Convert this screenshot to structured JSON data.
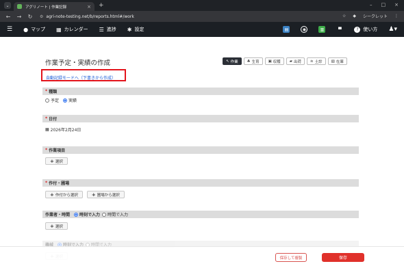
{
  "browser": {
    "tab_title": "アグリノート | 作業記録",
    "url": "agri-note-testing.net/b/reports.html#/work",
    "profile_label": "シークレット"
  },
  "nav": {
    "map": "マップ",
    "calendar": "カレンダー",
    "progress": "進捗",
    "settings": "設定",
    "help": "使い方"
  },
  "page": {
    "title": "作業予定・実績の作成",
    "auto_link": "自動記録モードへ（下書きから作成）"
  },
  "work_tabs": [
    "作業",
    "生育",
    "収穫",
    "出荷",
    "土診",
    "在庫"
  ],
  "sections": {
    "kind": {
      "label": "種類",
      "options": [
        "予定",
        "実績"
      ],
      "selected": "実績"
    },
    "date": {
      "label": "日付",
      "value": "2026年2月24日"
    },
    "item": {
      "label": "作業項目",
      "button": "選択"
    },
    "crop": {
      "label": "作付・圃場",
      "button1": "作付から選択",
      "button2": "圃場から選択"
    },
    "worker": {
      "label": "作業者・時間",
      "opt1": "時刻で入力",
      "opt2": "時間で入力",
      "button": "選択"
    },
    "machine": {
      "label": "機械",
      "opt1": "時刻で入力",
      "opt2": "時間で入力",
      "button": "選択"
    }
  },
  "footer": {
    "draft": "保存して複製",
    "save": "保存"
  },
  "colors": {
    "accent_red": "#e0312b",
    "link_blue": "#1a5bd6",
    "nav_bg": "#1b1f24"
  }
}
